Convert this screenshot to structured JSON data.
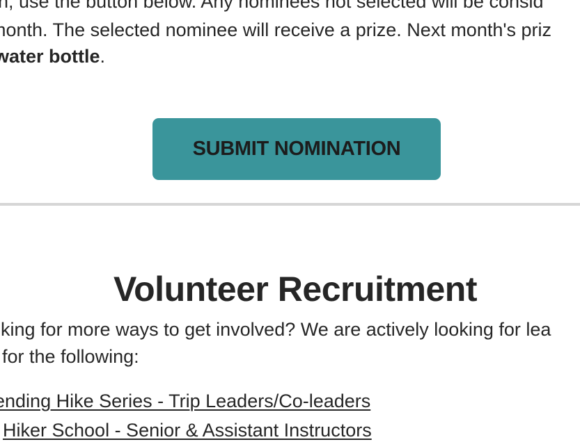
{
  "intro": {
    "line1": "on, use the button below. Any nominees not selected will be consid",
    "line2": "month. The selected nominee will receive a prize. Next month's priz",
    "line3_bold": "water bottle",
    "line3_suffix": "."
  },
  "submit_button": {
    "label": "SUBMIT NOMINATION",
    "color": "#3a959b"
  },
  "volunteer": {
    "title": "Volunteer Recruitment",
    "line1": "oking for more ways to get involved? We are actively looking for lea",
    "line2": "for the following:",
    "links": [
      "ending Hike Series - Trip Leaders/Co-leaders",
      "Hiker School - Senior & Assistant Instructors"
    ]
  }
}
